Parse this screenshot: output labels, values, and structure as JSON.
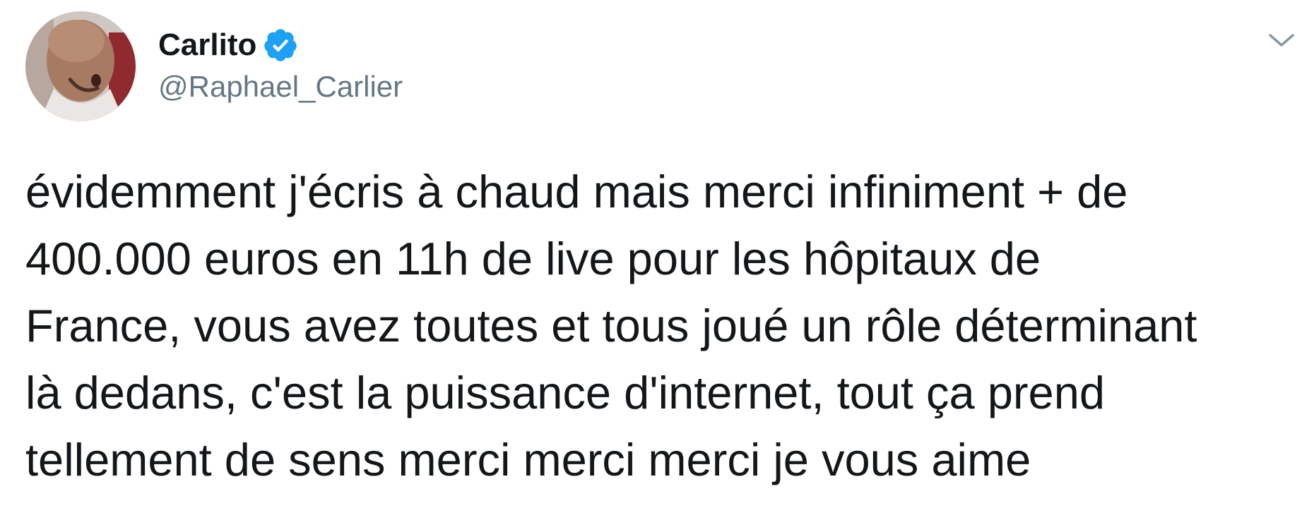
{
  "author": {
    "display_name": "Carlito",
    "handle": "@Raphael_Carlier",
    "verified_icon": "verified-badge-icon",
    "avatar_icon": "avatar"
  },
  "menu": {
    "icon": "chevron-down-icon"
  },
  "tweet": {
    "lines": [
      "évidemment j'écris à chaud mais merci infiniment + de",
      "400.000 euros en 11h de live pour les hôpitaux de",
      "France, vous avez toutes et tous joué un rôle déterminant",
      "là dedans, c'est la puissance d'internet, tout ça prend",
      "tellement de sens merci merci merci je vous aime"
    ]
  },
  "colors": {
    "text": "#14171a",
    "secondary": "#657786",
    "verified": "#1da1f2",
    "chevron": "#8899a6"
  }
}
